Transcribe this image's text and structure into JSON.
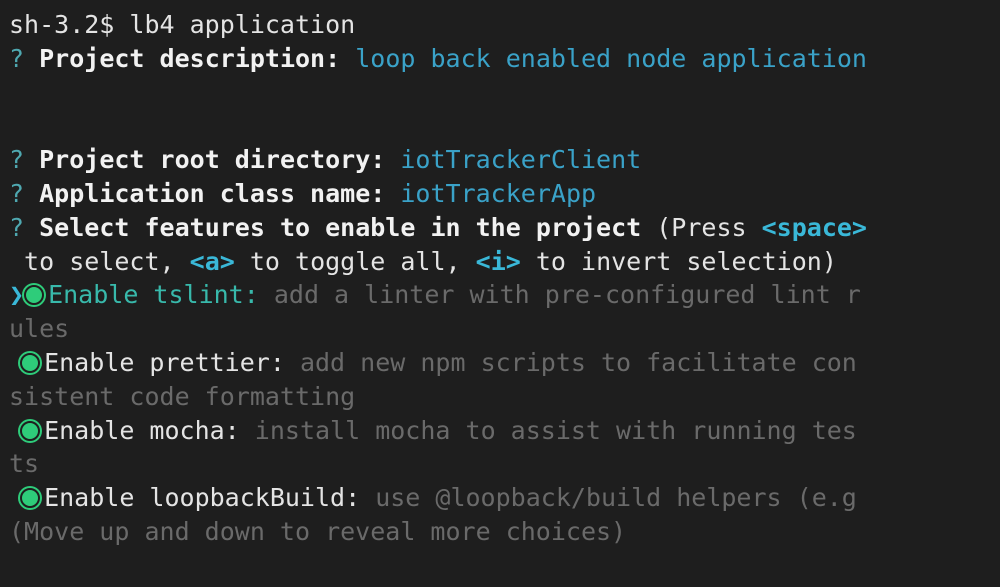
{
  "terminal": {
    "prompt_line": "sh-3.2$ lb4 application",
    "q_mark": "?",
    "project_description_label": "Project description:",
    "project_description_value": "loop back enabled node application",
    "project_root_label": "Project root directory:",
    "project_root_value": "iotTrackerClient",
    "app_class_label": "Application class name:",
    "app_class_value": "iotTrackerApp",
    "features_label": "Select features to enable in the project",
    "features_hint": {
      "press": "(Press",
      "space_key": "<space>",
      "line2_lead": " to select,",
      "a_key": "<a>",
      "toggle": "to toggle all,",
      "i_key": "<i>",
      "invert": "to invert selection)"
    },
    "pointer_glyph": "❯",
    "options": [
      {
        "name": "Enable tslint:",
        "desc_line1": "add a linter with pre-configured lint r",
        "desc_line2": "ules",
        "selected": true,
        "highlighted": true
      },
      {
        "name": "Enable prettier:",
        "desc_line1": "add new npm scripts to facilitate con",
        "desc_line2": "sistent code formatting",
        "selected": true,
        "highlighted": false
      },
      {
        "name": "Enable mocha:",
        "desc_line1": "install mocha to assist with running tes",
        "desc_line2": "ts",
        "selected": true,
        "highlighted": false
      },
      {
        "name": "Enable loopbackBuild:",
        "desc_line1": "use @loopback/build helpers (e.g",
        "selected": true,
        "highlighted": false
      }
    ],
    "scroll_hint": "(Move up and down to reveal more choices)",
    "colors": {
      "background": "#1e1e1e",
      "answer": "#3aa2c8",
      "key_hint": "#3ab8d8",
      "radio_selected": "#2ecc7a",
      "dim_text": "#6a6a6a"
    }
  }
}
